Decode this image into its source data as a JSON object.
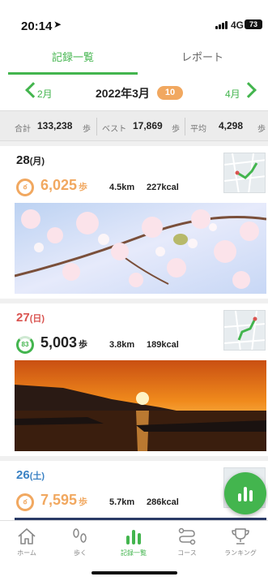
{
  "status_bar": {
    "time": "20:14",
    "network": "4G",
    "battery": "73"
  },
  "tabs": [
    {
      "label": "記録一覧",
      "active": true
    },
    {
      "label": "レポート",
      "active": false
    }
  ],
  "month_nav": {
    "prev": "2月",
    "title": "2022年3月",
    "badge": "10",
    "next": "4月"
  },
  "summary": {
    "total_label": "合計",
    "total_value": "133,238",
    "total_unit": "歩",
    "best_label": "ベスト",
    "best_value": "17,869",
    "best_unit": "歩",
    "avg_label": "平均",
    "avg_value": "4,298",
    "avg_unit": "歩"
  },
  "days": [
    {
      "day": "28",
      "weekday": "(月)",
      "steps": "6,025",
      "unit": "歩",
      "distance": "4.5km",
      "kcal": "227kcal",
      "day_color": "#222222",
      "steps_color": "#f1a860"
    },
    {
      "day": "27",
      "weekday": "(日)",
      "ring_value": "83",
      "steps": "5,003",
      "unit": "歩",
      "distance": "3.8km",
      "kcal": "189kcal",
      "day_color": "#d9534f",
      "steps_color": "#222222"
    },
    {
      "day": "26",
      "weekday": "(土)",
      "steps": "7,595",
      "unit": "歩",
      "distance": "5.7km",
      "kcal": "286kcal",
      "day_color": "#3b82c4",
      "steps_color": "#f1a860"
    }
  ],
  "bottom_nav": [
    {
      "label": "ホーム",
      "icon": "home-icon",
      "active": false
    },
    {
      "label": "歩く",
      "icon": "footprints-icon",
      "active": false
    },
    {
      "label": "記録一覧",
      "icon": "bar-chart-icon",
      "active": true
    },
    {
      "label": "コース",
      "icon": "route-icon",
      "active": false
    },
    {
      "label": "ランキング",
      "icon": "trophy-icon",
      "active": false
    }
  ],
  "colors": {
    "accent": "#43b54e",
    "badge": "#f1a860"
  }
}
